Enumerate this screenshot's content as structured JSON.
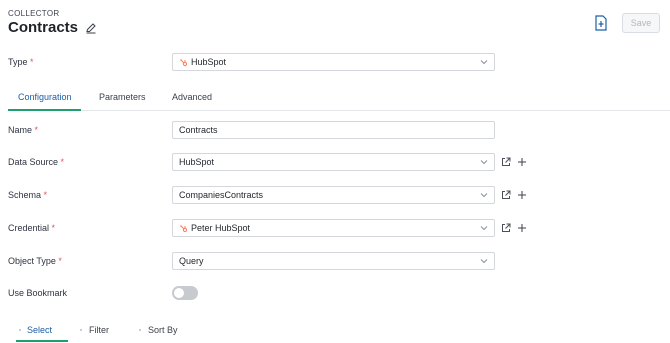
{
  "header": {
    "breadcrumb": "COLLECTOR",
    "title": "Contracts",
    "save_label": "Save"
  },
  "type_field": {
    "label": "Type",
    "value": "HubSpot"
  },
  "tabs": [
    {
      "label": "Configuration",
      "active": true
    },
    {
      "label": "Parameters",
      "active": false
    },
    {
      "label": "Advanced",
      "active": false
    }
  ],
  "form": {
    "name": {
      "label": "Name",
      "value": "Contracts"
    },
    "data_source": {
      "label": "Data Source",
      "value": "HubSpot"
    },
    "schema": {
      "label": "Schema",
      "value": "CompaniesContracts"
    },
    "credential": {
      "label": "Credential",
      "value": "Peter HubSpot"
    },
    "object_type": {
      "label": "Object Type",
      "value": "Query"
    },
    "use_bookmark": {
      "label": "Use Bookmark",
      "enabled": false
    }
  },
  "required_marker": "*",
  "subtabs": [
    {
      "label": "Select",
      "active": true
    },
    {
      "label": "Filter",
      "active": false
    },
    {
      "label": "Sort By",
      "active": false
    }
  ],
  "colors": {
    "accent": "#1c5fa8",
    "tab_underline": "#1f9e6e",
    "required": "#e0565b",
    "hubspot": "#ff7a59"
  },
  "icons": {
    "edit": "pencil-icon",
    "export": "file-export-icon",
    "chevron": "chevron-down-icon",
    "open_external": "external-link-icon",
    "add": "plus-icon",
    "hubspot": "hubspot-logo-icon"
  }
}
